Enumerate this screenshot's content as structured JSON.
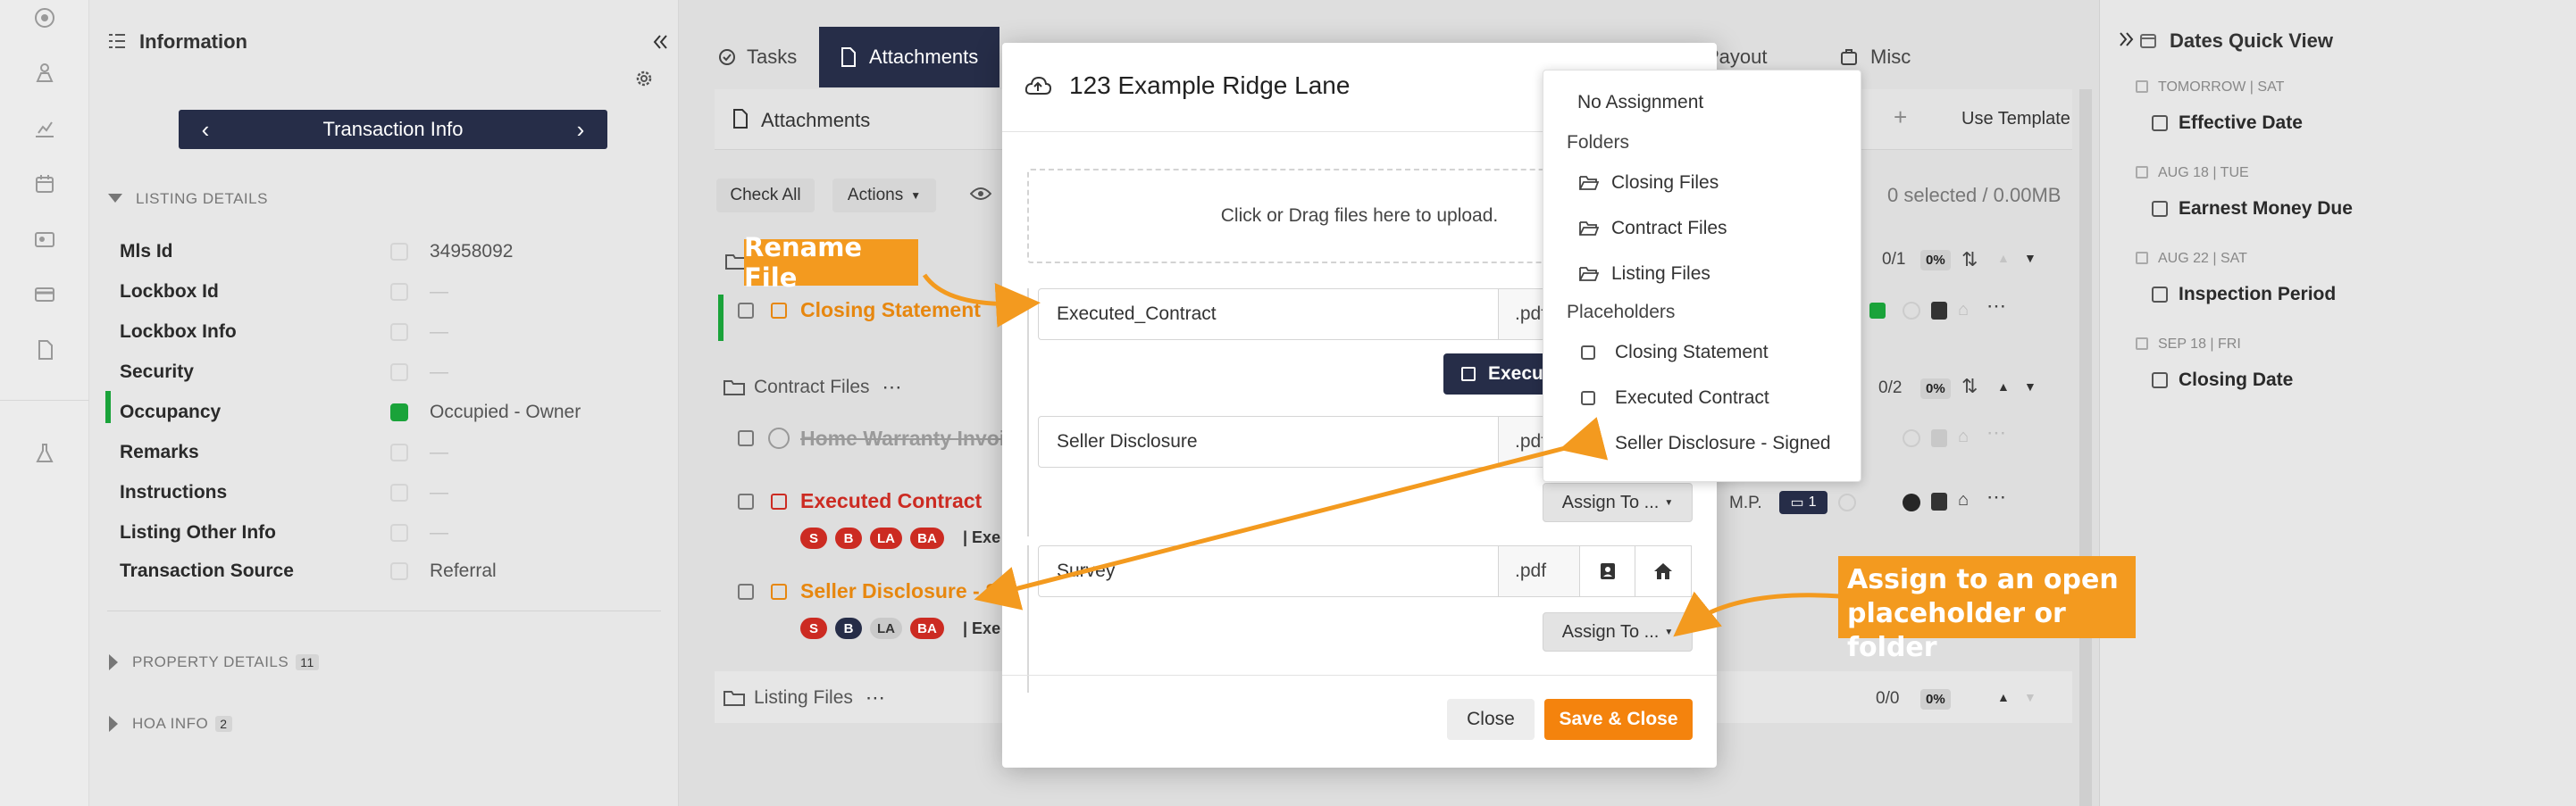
{
  "info_panel": {
    "title": "Information",
    "nav_label": "Transaction Info",
    "listing_details_label": "LISTING DETAILS",
    "fields": [
      {
        "label": "Mls Id",
        "value": "34958092",
        "dim": false
      },
      {
        "label": "Lockbox Id",
        "value": "—",
        "dim": true
      },
      {
        "label": "Lockbox Info",
        "value": "—",
        "dim": true
      },
      {
        "label": "Security",
        "value": "—",
        "dim": true
      },
      {
        "label": "Occupancy",
        "value": "Occupied - Owner",
        "dim": false
      },
      {
        "label": "Remarks",
        "value": "—",
        "dim": true
      },
      {
        "label": "Instructions",
        "value": "—",
        "dim": true
      },
      {
        "label": "Listing Other Info",
        "value": "—",
        "dim": true
      },
      {
        "label": "Transaction Source",
        "value": "Referral",
        "dim": false
      }
    ],
    "property_details_label": "PROPERTY DETAILS",
    "property_details_count": "11",
    "hoa_info_label": "HOA INFO",
    "hoa_info_count": "2"
  },
  "tabs": {
    "tasks": "Tasks",
    "attachments": "Attachments",
    "payout": "Payout",
    "misc": "Misc"
  },
  "attachments": {
    "header": "Attachments",
    "use_template": "Use Template",
    "check_all": "Check All",
    "actions": "Actions",
    "selected_summary": "0 selected / 0.00MB",
    "folders": [
      {
        "name": "Contract Files",
        "count": "0/2",
        "pct": "0%"
      },
      {
        "name": "Listing Files",
        "count": "0/0",
        "pct": "0%"
      }
    ],
    "closing_count": "0/1",
    "closing_pct": "0%",
    "files": {
      "closing_statement": "Closing Statement",
      "home_warranty": "Home Warranty Invoi",
      "executed_contract": "Executed Contract",
      "seller_disclosure": "Seller Disclosure - S"
    },
    "pills": [
      "S",
      "B",
      "LA",
      "BA"
    ],
    "exec_suffix": "Exe",
    "mp_label": "M.P.",
    "comment_count": "1"
  },
  "right_panel": {
    "title": "Dates Quick View",
    "items": [
      {
        "date": "TOMORROW | SAT",
        "label": "Effective Date"
      },
      {
        "date": "AUG 18 | TUE",
        "label": "Earnest Money Due"
      },
      {
        "date": "AUG 22 | SAT",
        "label": "Inspection Period"
      },
      {
        "date": "SEP 18 | FRI",
        "label": "Closing Date"
      }
    ]
  },
  "modal": {
    "title": "123 Example Ridge Lane",
    "dropzone_text": "Click or Drag files here to upload.",
    "files": [
      {
        "name": "Executed_Contract",
        "ext": ".pdf"
      },
      {
        "name": "Seller Disclosure",
        "ext": ".pdf"
      },
      {
        "name": "Survey",
        "ext": ".pdf"
      }
    ],
    "exec_button": "Execu",
    "assign_label": "Assign To ...",
    "close_label": "Close",
    "save_label": "Save & Close"
  },
  "dropdown": {
    "no_assignment": "No Assignment",
    "folders_header": "Folders",
    "folders": [
      "Closing Files",
      "Contract Files",
      "Listing Files"
    ],
    "placeholders_header": "Placeholders",
    "placeholders": [
      "Closing Statement",
      "Executed Contract",
      "Seller Disclosure - Signed"
    ]
  },
  "callouts": {
    "rename": "Rename File",
    "assign_line1": "Assign to an open",
    "assign_line2": "placeholder or folder"
  },
  "colors": {
    "navy": "#262d48",
    "orange": "#f4830d",
    "callout": "#f39a1f",
    "red": "#cc2b22",
    "green": "#1aa33a"
  }
}
